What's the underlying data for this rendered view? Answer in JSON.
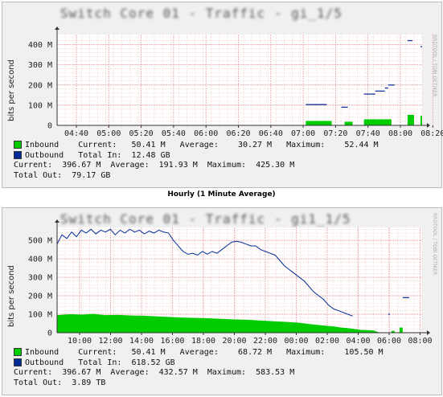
{
  "caption": "Hourly (1 Minute Average)",
  "colors": {
    "inbound": "#00cc00",
    "outbound": "#002a97",
    "grid": "#e8b0b0",
    "background": "#f0f0f0"
  },
  "chart_data": [
    {
      "type": "area",
      "title": "Switch Core 01 - Traffic - gi_1/5",
      "ylabel": "bits per second",
      "side_label": "RRDTOOL / TOBI OETIKER",
      "ylim": [
        0,
        450
      ],
      "y_unit": "M",
      "y_ticks": [
        "0",
        "100 M",
        "200 M",
        "300 M",
        "400 M"
      ],
      "x_ticks": [
        "04:40",
        "05:00",
        "05:20",
        "05:40",
        "06:00",
        "06:20",
        "06:40",
        "07:00",
        "07:20",
        "07:40",
        "08:00",
        "08:20"
      ],
      "series": [
        {
          "name": "Inbound",
          "kind": "area",
          "color": "#00cc00",
          "x": [
            0,
            103,
            104,
            110,
            111,
            114,
            115,
            116,
            117,
            118,
            119,
            120,
            121,
            122,
            123,
            124,
            125,
            126,
            127,
            128,
            129,
            130,
            131,
            132,
            133,
            134,
            135,
            136,
            137,
            138,
            139,
            140,
            141,
            142,
            143,
            144,
            145,
            146,
            147,
            148,
            149,
            150,
            151,
            152,
            153,
            154,
            155,
            156,
            157,
            158,
            159,
            160,
            161,
            162,
            163,
            164,
            165,
            166,
            167,
            168,
            169,
            170,
            171,
            172,
            173,
            174,
            175,
            176,
            177,
            178,
            179,
            180,
            181,
            182,
            183,
            184,
            185,
            186,
            187,
            188,
            189,
            190,
            191,
            192,
            193,
            194,
            195,
            196,
            197,
            198,
            199,
            200,
            201,
            202,
            203,
            204,
            205,
            206,
            207,
            208,
            209,
            210,
            211,
            212,
            213,
            214,
            215,
            216,
            217,
            218,
            219,
            220,
            221,
            222,
            223,
            224,
            225,
            226
          ],
          "values": [
            null,
            null,
            null,
            null,
            null,
            null,
            null,
            null,
            null,
            null,
            null,
            null,
            null,
            null,
            null,
            null,
            null,
            null,
            null,
            null,
            null,
            null,
            null,
            null,
            null,
            null,
            null,
            null,
            null,
            null,
            null,
            null,
            null,
            null,
            null,
            null,
            null,
            null,
            null,
            null,
            null,
            null,
            null,
            null,
            null,
            null,
            null,
            null,
            null,
            null,
            null,
            null,
            null,
            null,
            null,
            null,
            null,
            null,
            null,
            null,
            null,
            null,
            null,
            null,
            null,
            null,
            null,
            null,
            null,
            null,
            null,
            null,
            null,
            null,
            null,
            null,
            null,
            null,
            null,
            null,
            null,
            null,
            null,
            null,
            null,
            null,
            null,
            null,
            null,
            null,
            null,
            null,
            null,
            null,
            null,
            null,
            null,
            null,
            null,
            null,
            null,
            null,
            null,
            null,
            null,
            null,
            null,
            null,
            null,
            null,
            null,
            null,
            null,
            null,
            null,
            null,
            null,
            null
          ],
          "segments": [
            {
              "x0": 154,
              "x1": 170,
              "value": 22
            },
            {
              "x0": 178,
              "x1": 183,
              "value": 18
            },
            {
              "x0": 190,
              "x1": 207,
              "value": 30
            },
            {
              "x0": 217,
              "x1": 221,
              "value": 52
            },
            {
              "x0": 225,
              "x1": 226,
              "value": 48
            }
          ]
        },
        {
          "name": "Outbound",
          "kind": "line",
          "color": "#002a97",
          "segments": [
            {
              "x0": 154,
              "x1": 167,
              "value": 103
            },
            {
              "x0": 176,
              "x1": 180,
              "value": 90
            },
            {
              "x0": 190,
              "x1": 197,
              "value": 155
            },
            {
              "x0": 197,
              "x1": 203,
              "value": 170
            },
            {
              "x0": 203,
              "x1": 205,
              "value": 185
            },
            {
              "x0": 205,
              "x1": 209,
              "value": 200
            },
            {
              "x0": 217,
              "x1": 220,
              "value": 420
            },
            {
              "x0": 225,
              "x1": 226,
              "value": 390
            }
          ]
        }
      ],
      "legend": {
        "inbound_label": "Inbound",
        "inbound_current": "50.41 M",
        "inbound_average": "30.27 M",
        "inbound_maximum": "52.44 M",
        "outbound_label": "Outbound",
        "outbound_total_in": "12.48 GB",
        "outbound_current": "396.67 M",
        "outbound_average": "191.93 M",
        "outbound_maximum": "425.30 M",
        "total_out": "79.17 GB"
      }
    },
    {
      "type": "area",
      "title": "Switch Core 01 - Traffic - gi1_1/5",
      "ylabel": "bits per second",
      "side_label": "RRDTOOL / TOBI OETIKER",
      "ylim": [
        0,
        570
      ],
      "y_unit": "M",
      "y_ticks": [
        "0",
        "100 M",
        "200 M",
        "300 M",
        "400 M",
        "500 M"
      ],
      "x_ticks": [
        "10:00",
        "12:00",
        "14:00",
        "16:00",
        "18:00",
        "20:00",
        "22:00",
        "00:00",
        "02:00",
        "04:00",
        "06:00",
        "08:00"
      ],
      "series": [
        {
          "name": "Inbound",
          "kind": "area",
          "color": "#00cc00",
          "points": [
            [
              0,
              95
            ],
            [
              8,
              100
            ],
            [
              16,
              98
            ],
            [
              22,
              102
            ],
            [
              30,
              95
            ],
            [
              38,
              96
            ],
            [
              46,
              93
            ],
            [
              54,
              92
            ],
            [
              62,
              88
            ],
            [
              70,
              85
            ],
            [
              78,
              82
            ],
            [
              86,
              80
            ],
            [
              94,
              78
            ],
            [
              102,
              75
            ],
            [
              110,
              72
            ],
            [
              118,
              70
            ],
            [
              126,
              66
            ],
            [
              134,
              62
            ],
            [
              142,
              58
            ],
            [
              150,
              54
            ],
            [
              158,
              45
            ],
            [
              166,
              38
            ],
            [
              172,
              33
            ],
            [
              176,
              28
            ],
            [
              180,
              25
            ],
            [
              184,
              20
            ],
            [
              188,
              15
            ],
            [
              192,
              14
            ],
            [
              196,
              12
            ],
            [
              200,
              0
            ],
            [
              225,
              0
            ]
          ],
          "tail_segments": [
            {
              "x0": 207,
              "x1": 209,
              "value": 10
            },
            {
              "x0": 212,
              "x1": 214,
              "value": 28
            }
          ]
        },
        {
          "name": "Outbound",
          "kind": "line",
          "color": "#002a97",
          "points": [
            [
              0,
              480
            ],
            [
              3,
              530
            ],
            [
              6,
              510
            ],
            [
              9,
              545
            ],
            [
              12,
              520
            ],
            [
              15,
              555
            ],
            [
              18,
              540
            ],
            [
              21,
              560
            ],
            [
              24,
              535
            ],
            [
              27,
              555
            ],
            [
              30,
              545
            ],
            [
              33,
              560
            ],
            [
              36,
              530
            ],
            [
              39,
              555
            ],
            [
              42,
              540
            ],
            [
              45,
              560
            ],
            [
              48,
              545
            ],
            [
              51,
              555
            ],
            [
              54,
              535
            ],
            [
              57,
              550
            ],
            [
              60,
              540
            ],
            [
              63,
              555
            ],
            [
              66,
              545
            ],
            [
              69,
              540
            ],
            [
              72,
              500
            ],
            [
              75,
              470
            ],
            [
              78,
              440
            ],
            [
              81,
              425
            ],
            [
              84,
              430
            ],
            [
              87,
              420
            ],
            [
              90,
              440
            ],
            [
              93,
              425
            ],
            [
              96,
              440
            ],
            [
              99,
              430
            ],
            [
              102,
              450
            ],
            [
              105,
              470
            ],
            [
              108,
              490
            ],
            [
              111,
              495
            ],
            [
              114,
              490
            ],
            [
              117,
              480
            ],
            [
              120,
              470
            ],
            [
              123,
              470
            ],
            [
              126,
              450
            ],
            [
              129,
              440
            ],
            [
              132,
              430
            ],
            [
              135,
              420
            ],
            [
              138,
              390
            ],
            [
              141,
              360
            ],
            [
              144,
              340
            ],
            [
              147,
              320
            ],
            [
              150,
              300
            ],
            [
              153,
              280
            ],
            [
              156,
              250
            ],
            [
              159,
              220
            ],
            [
              162,
              200
            ],
            [
              165,
              180
            ],
            [
              168,
              150
            ],
            [
              171,
              130
            ],
            [
              174,
              120
            ],
            [
              177,
              110
            ],
            [
              180,
              100
            ],
            [
              183,
              90
            ]
          ],
          "tail_segments": [
            {
              "x0": 205,
              "x1": 206,
              "value": 100
            },
            {
              "x0": 214,
              "x1": 218,
              "value": 190
            }
          ]
        }
      ],
      "legend": {
        "inbound_label": "Inbound",
        "inbound_current": "50.41 M",
        "inbound_average": "68.72 M",
        "inbound_maximum": "105.50 M",
        "outbound_label": "Outbound",
        "outbound_total_in": "618.52 GB",
        "outbound_current": "396.67 M",
        "outbound_average": "432.57 M",
        "outbound_maximum": "583.53 M",
        "total_out": "3.89 TB"
      }
    }
  ]
}
